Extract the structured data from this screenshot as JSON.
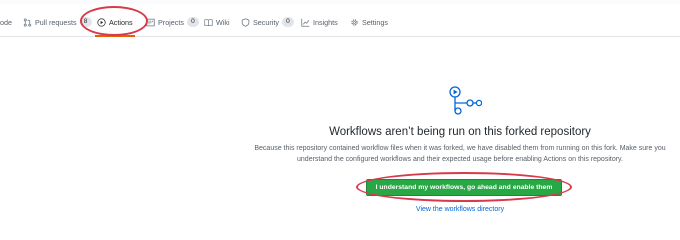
{
  "tabs": [
    {
      "label": "ode",
      "icon": "code-icon"
    },
    {
      "label": "Pull requests",
      "icon": "pull-request-icon",
      "count": "8"
    },
    {
      "label": "Actions",
      "icon": "play-icon",
      "selected": true
    },
    {
      "label": "Projects",
      "icon": "project-icon",
      "count": "0"
    },
    {
      "label": "Wiki",
      "icon": "book-icon"
    },
    {
      "label": "Security",
      "icon": "shield-icon",
      "count": "0"
    },
    {
      "label": "Insights",
      "icon": "graph-icon"
    },
    {
      "label": "Settings",
      "icon": "gear-icon"
    }
  ],
  "empty_state": {
    "icon": "workflow-icon",
    "title": "Workflows aren’t being run on this forked repository",
    "description": "Because this repository contained workflow files when it was forked, we have disabled them from running on this fork. Make sure you understand the configured workflows and their expected usage before enabling Actions on this repository.",
    "button_label": "I understand my workflows, go ahead and enable them",
    "link_label": "View the workflows directory"
  },
  "colors": {
    "annotation": "#d73a49",
    "primary_button": "#28a745",
    "link": "#0366d6",
    "selected_tab_underline": "#e36209"
  }
}
